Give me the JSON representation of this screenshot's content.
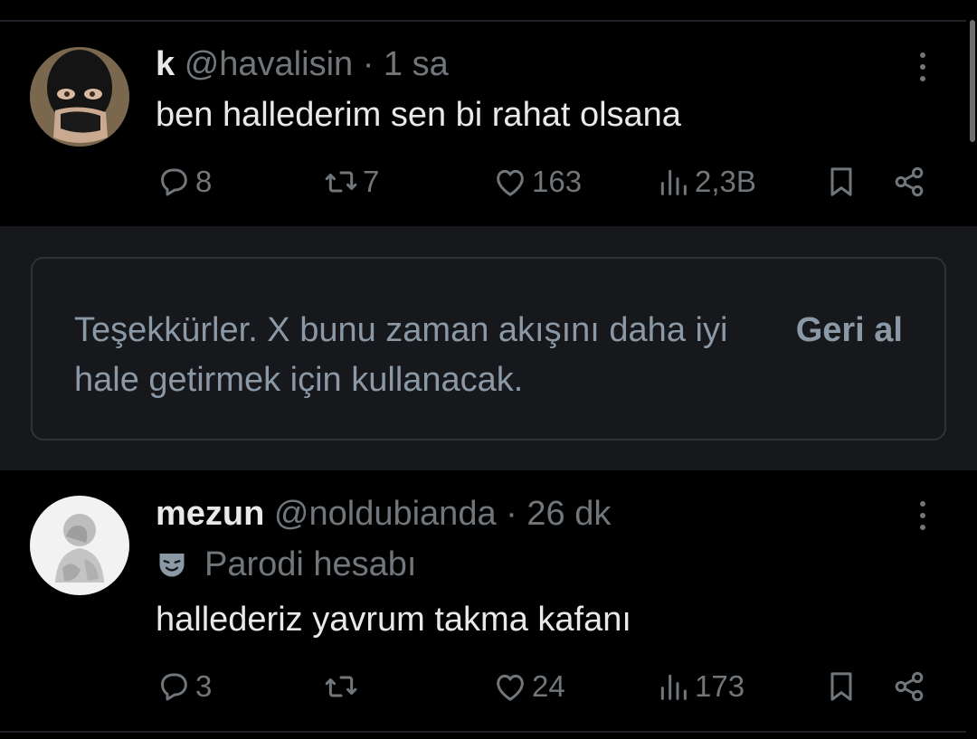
{
  "tweets": [
    {
      "name": "k",
      "handle": "@havalisin",
      "separator": "·",
      "time": "1 sa",
      "text": "ben hallederim sen bi rahat olsana",
      "counts": {
        "replies": "8",
        "retweets": "7",
        "likes": "163",
        "views": "2,3B"
      }
    },
    {
      "name": "mezun",
      "handle": "@noldubianda",
      "separator": "·",
      "time": "26 dk",
      "badge": "Parodi hesabı",
      "text": "hallederiz yavrum takma kafanı",
      "counts": {
        "replies": "3",
        "retweets": "",
        "likes": "24",
        "views": "173"
      }
    }
  ],
  "feedback": {
    "message": "Teşekkürler. X bunu zaman akışını daha iyi hale getirmek için kullanacak.",
    "undo_label": "Geri al"
  },
  "icons": [
    "reply-icon",
    "retweet-icon",
    "like-icon",
    "views-icon",
    "bookmark-icon",
    "share-icon",
    "more-icon",
    "parody-mask-icon"
  ],
  "colors": {
    "background": "#000000",
    "text": "#e7e9ea",
    "muted": "#71767b",
    "feedback_bg": "#16181c"
  }
}
